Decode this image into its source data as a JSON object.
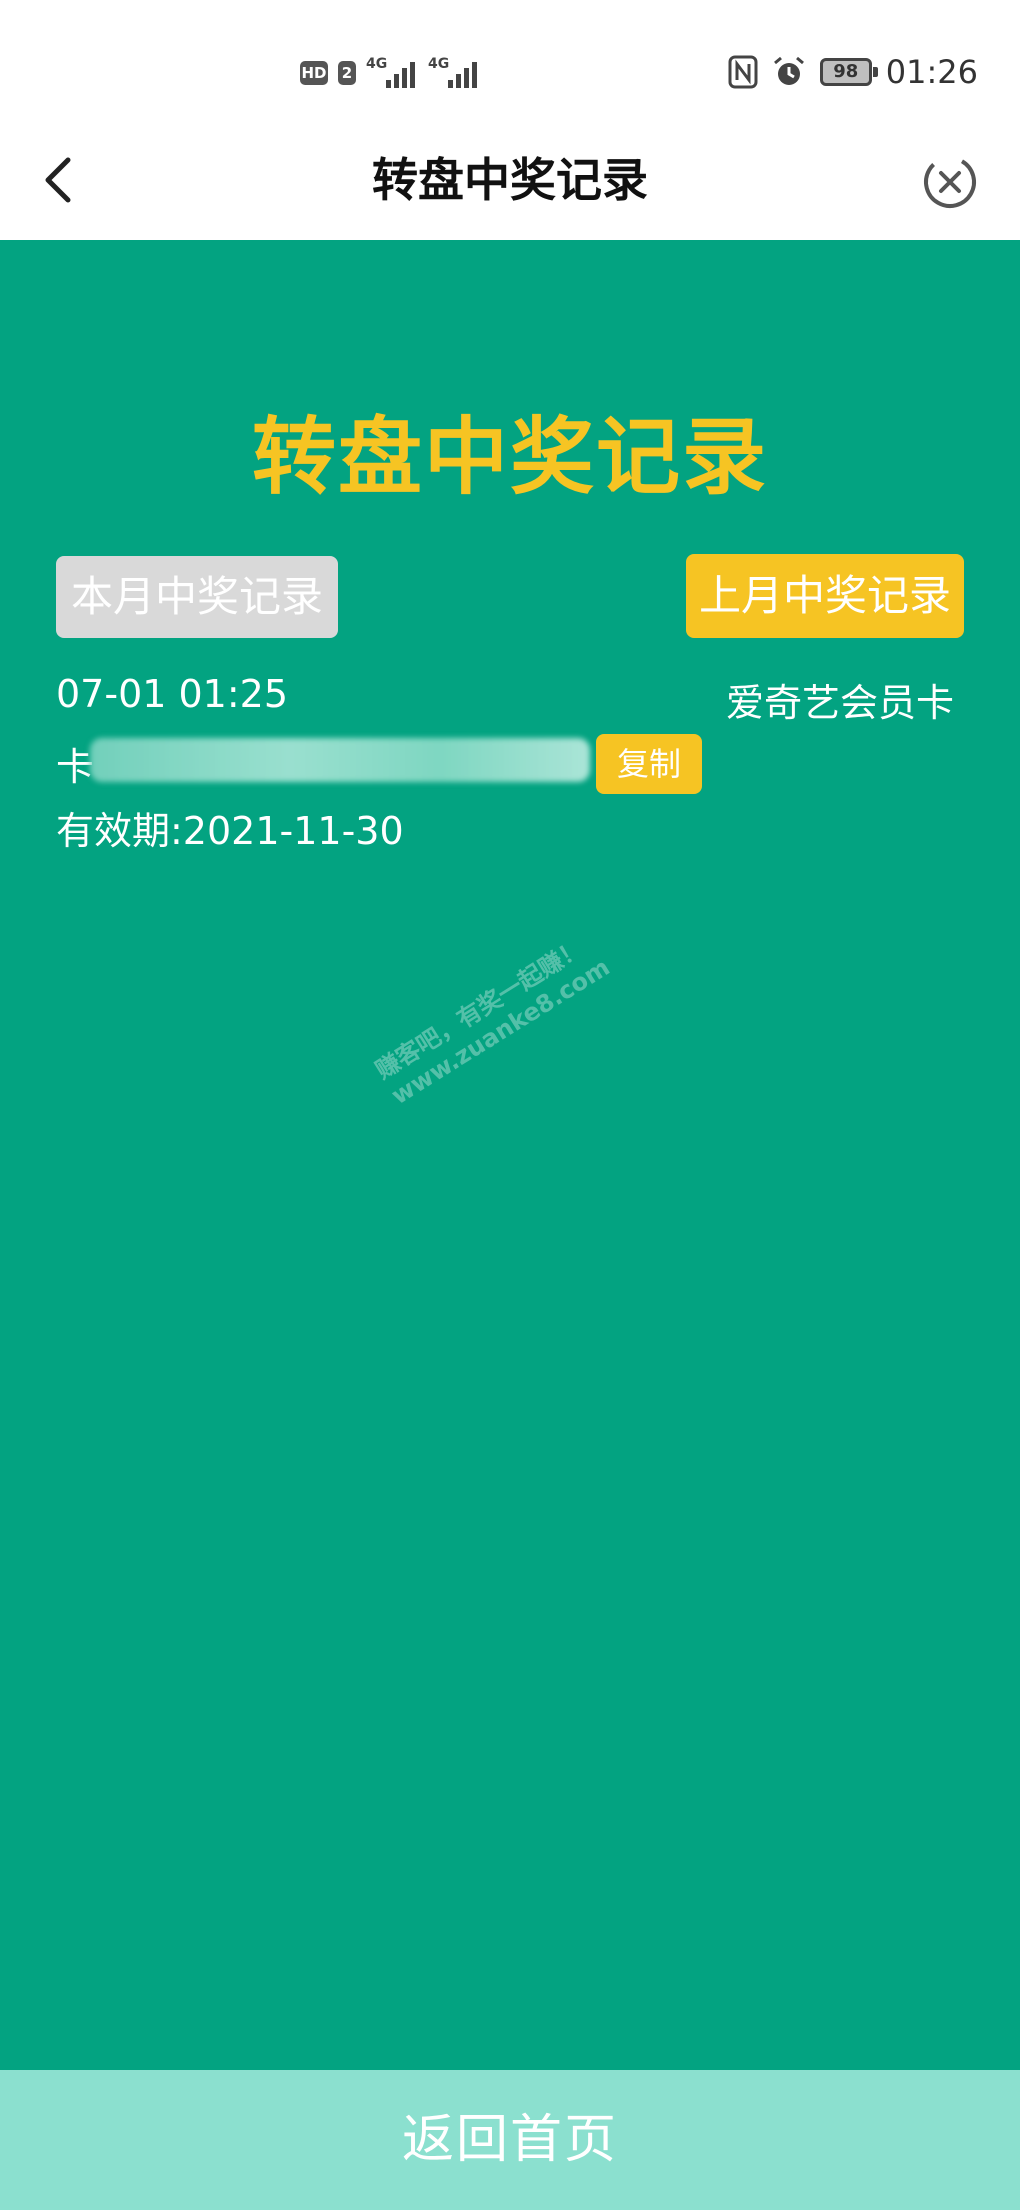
{
  "status_bar": {
    "hd_label": "HD",
    "sim_label": "2",
    "network_1": "4G",
    "network_2": "4G",
    "battery": "98",
    "time": "01:26"
  },
  "nav": {
    "title": "转盘中奖记录"
  },
  "page": {
    "heading": "转盘中奖记录",
    "tab_this_month": "本月中奖记录",
    "tab_last_month": "上月中奖记录"
  },
  "record": {
    "date": "07-01 01:25",
    "prize": "爱奇艺会员卡",
    "card_label": "卡",
    "copy_label": "复制",
    "valid_until": "有效期:2021-11-30"
  },
  "watermark": {
    "line1": "赚客吧，有奖一起赚！",
    "line2": "www.zuanke8.com"
  },
  "footer": {
    "home_label": "返回首页"
  },
  "colors": {
    "background": "#03a381",
    "accent_yellow": "#f6c423",
    "tab_inactive": "#d9d9d9",
    "footer_bg": "#8be0cf"
  }
}
